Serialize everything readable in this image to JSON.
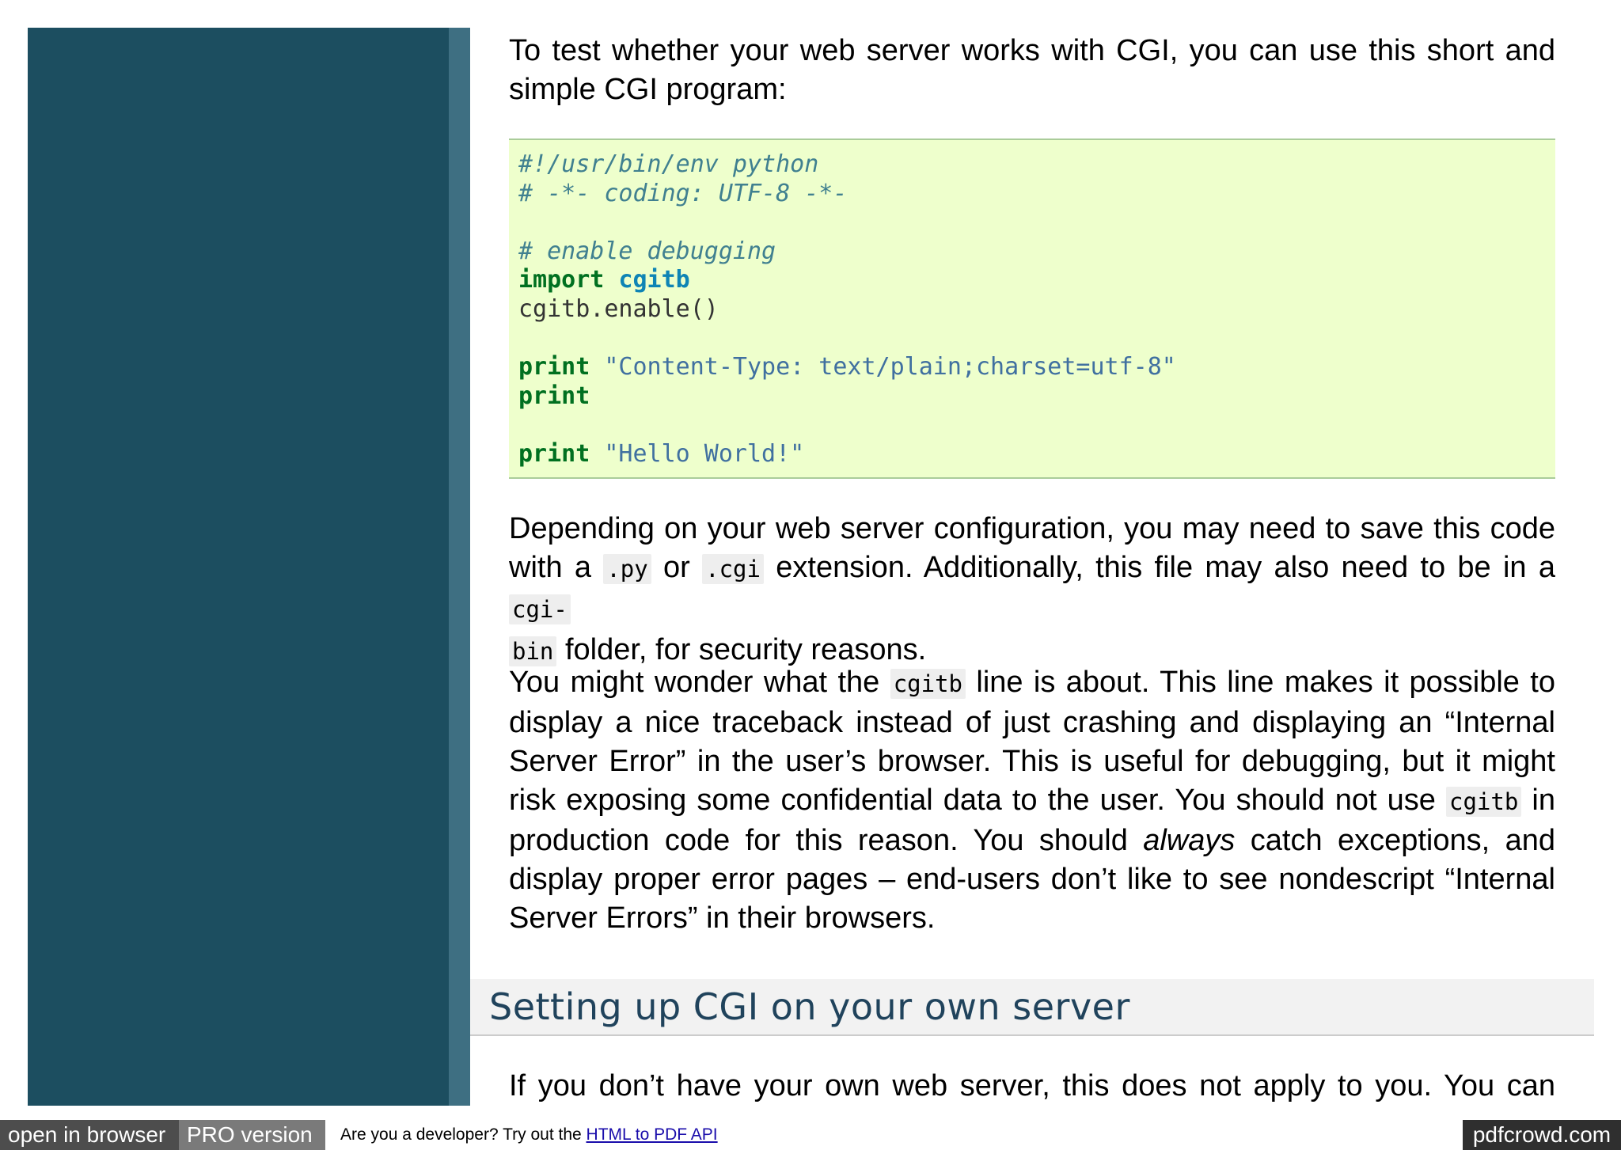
{
  "intro": {
    "text": "To test whether your web server works with CGI, you can use this short and simple CGI program:"
  },
  "code": {
    "line1": "#!/usr/bin/env python",
    "line2": "# -*- coding: UTF-8 -*-",
    "line3": "# enable debugging",
    "import_kw": "import",
    "import_mod": "cgitb",
    "line5": "cgitb.enable()",
    "print_kw": "print",
    "print1_str": "\"Content-Type: text/plain;charset=utf-8\"",
    "print3_str": "\"Hello World!\""
  },
  "depend": {
    "t1": "Depending on your web server configuration, you may need to save this code with a ",
    "c1": ".py",
    "t2": " or ",
    "c2": ".cgi",
    "t3": " extension. Additionally, this file may also need to be in a ",
    "c3a": "cgi-",
    "c3b": "bin",
    "t4": " folder, for security reasons."
  },
  "wonder": {
    "t1": "You might wonder what the ",
    "c1": "cgitb",
    "t2": " line is about. This line makes it possible to display a nice traceback instead of just crashing and displaying an “Internal Server Error” in the user’s browser. This is useful for debugging, but it might risk exposing some confidential data to the user. You should not use ",
    "c2": "cgitb",
    "t3": " in production code for this reason. You should ",
    "em": "always",
    "t4": " catch exceptions, and display proper error pages – end-users don’t like to see nondescript “Internal Server Errors” in their browsers."
  },
  "section": {
    "title": "Setting up CGI on your own server"
  },
  "ifyou": {
    "text": "If you don’t have your own web server, this does not apply to you. You can"
  },
  "footer": {
    "open_label": "open in browser",
    "pro_label": "PRO version",
    "dev_prefix": "Are you a developer? Try out the ",
    "dev_link": "HTML to PDF API",
    "brand": "pdfcrowd.com"
  }
}
